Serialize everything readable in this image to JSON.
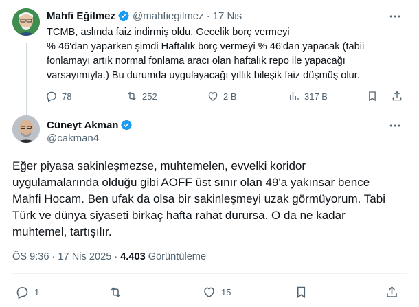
{
  "parent": {
    "author_name": "Mahfi Eğilmez",
    "handle": "@mahfiegilmez",
    "separator": "·",
    "date": "17 Nis",
    "text_lines": [
      "TCMB, aslında faiz indirmiş oldu. Gecelik borç vermeyi",
      "% 46'dan yaparken şimdi Haftalık borç vermeyi % 46'dan yapacak (tabii",
      "fonlamayı artık normal fonlama aracı olan haftalık repo ile yapacağı",
      "varsayımıyla.) Bu durumda uygulayacağı yıllık bileşik faiz düşmüş olur."
    ],
    "replies": "78",
    "reposts": "252",
    "likes": "2 B",
    "views": "317 B"
  },
  "reply": {
    "author_name": "Cüneyt Akman",
    "handle": "@cakman4",
    "text_lines": [
      "Eğer piyasa sakinleşmezse, muhtemelen, evvelki koridor",
      "uygulamalarında olduğu gibi AOFF  üst sınır olan 49'a yakınsar bence",
      "Mahfi Hocam. Ben ufak da olsa bir sakinleşmeyi uzak görmüyorum. Tabi",
      "Türk ve dünya siyaseti birkaç hafta rahat durursa. O da ne kadar",
      "muhtemel, tartışılır."
    ],
    "time": "ÖS 9:36",
    "separator": "·",
    "date": "17 Nis 2025",
    "views_count": "4.403",
    "views_label": "Görüntüleme",
    "replies": "1",
    "likes": "15"
  },
  "colors": {
    "verified": "#1d9bf0",
    "muted": "#536471",
    "text": "#0f1419",
    "divider": "#eff3f4"
  },
  "icons": [
    "verified-badge-icon",
    "more-icon",
    "reply-icon",
    "repost-icon",
    "like-icon",
    "views-icon",
    "bookmark-icon",
    "share-icon"
  ]
}
